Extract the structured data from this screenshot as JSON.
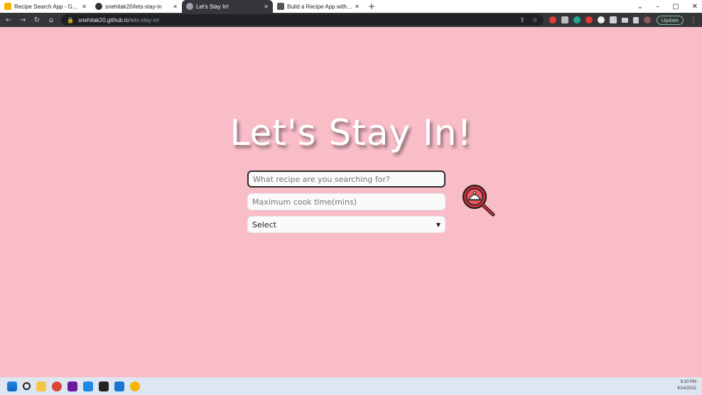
{
  "browser": {
    "tabs": [
      {
        "title": "Recipe Search App - Goog...",
        "active": false,
        "favicon_color": "#f4b400"
      },
      {
        "title": "snehitak20/lets-stay-in",
        "active": false,
        "favicon_color": "#333333"
      },
      {
        "title": "Let's Stay In!",
        "active": true,
        "favicon_color": "#9aa0a6"
      },
      {
        "title": "Build a Recipe App with...",
        "active": false,
        "favicon_color": "#555555"
      }
    ],
    "new_tab_glyph": "+",
    "address": {
      "host": "snehitak20.github.io",
      "path": "/lets-stay-in/"
    },
    "update_label": "Update"
  },
  "page": {
    "title": "Let's Stay In!",
    "search_placeholder": "What recipe are you searching for?",
    "time_placeholder": "Maximum cook time(mins)",
    "select_value": "Select",
    "accent_color": "#d62f3a"
  },
  "taskbar": {
    "time": "9:10 PM",
    "date": "4/14/2022"
  }
}
